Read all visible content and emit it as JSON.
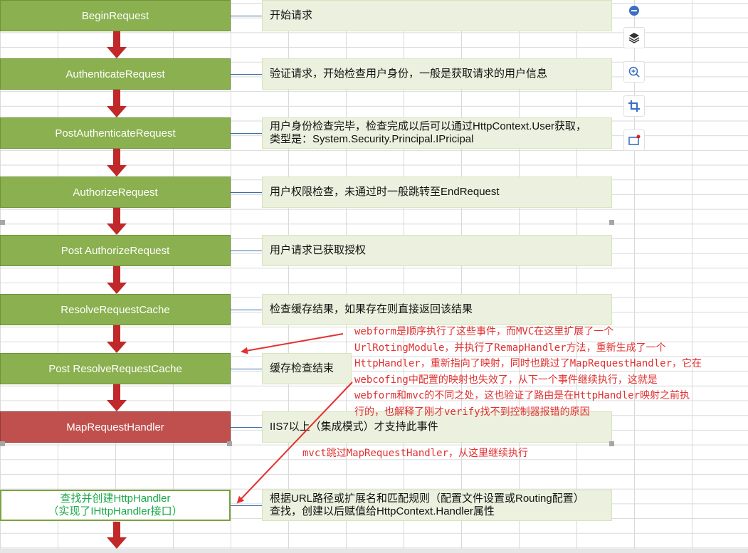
{
  "stages": [
    {
      "label": "BeginRequest",
      "note": "开始请求"
    },
    {
      "label": "AuthenticateRequest",
      "note": "验证请求，开始检查用户身份，一般是获取请求的用户信息"
    },
    {
      "label": "PostAuthenticateRequest",
      "note_line1": "用户身份检查完毕，检查完成以后可以通过HttpContext.User获取，",
      "note_line2": "类型是：System.Security.Principal.IPricipal"
    },
    {
      "label": "AuthorizeRequest",
      "note": "用户权限检查，未通过时一般跳转至EndRequest"
    },
    {
      "label": "Post AuthorizeRequest",
      "note": "用户请求已获取授权"
    },
    {
      "label": "ResolveRequestCache",
      "note": "检查缓存结果，如果存在则直接返回该结果"
    },
    {
      "label": "Post ResolveRequestCache",
      "note": "缓存检查结束"
    },
    {
      "label": "MapRequestHandler",
      "note": "IIS7以上（集成模式）才支持此事件"
    },
    {
      "label_line1": "查找并创建HttpHandler",
      "label_line2": "（实现了IHttpHandler接口）",
      "note_line1": "根据URL路径或扩展名和匹配规则（配置文件设置或Routing配置）",
      "note_line2": "查找，创建以后赋值给HttpContext.Handler属性"
    }
  ],
  "annotations": {
    "webform_lines": [
      "webform是顺序执行了这些事件，而MVC在这里扩展了一个",
      "UrlRotingModule，并执行了RemapHandler方法，重新生成了一个",
      "HttpHandler，重新指向了映射，同时也跳过了MapRequestHandler，它在",
      "webcofing中配置的映射也失效了，从下一个事件继续执行，这就是",
      "webform和mvc的不同之处，这也验证了路由是在HttpHandler映射之前执",
      "行的，也解释了刚才verify找不到控制器报错的原因"
    ],
    "mvc_line": "mvct跳过MapRequestHandler，从这里继续执行"
  },
  "colors": {
    "stage_green": "#8ab04f",
    "stage_red": "#c0504d",
    "note_bg": "#ebf1de",
    "arrow_red": "#e53030",
    "flow_arrow": "#c0282a"
  },
  "toolbar": {
    "icons": [
      "zoom-out-icon",
      "layers-icon",
      "zoom-in-icon",
      "crop-icon",
      "screenshot-icon"
    ]
  }
}
